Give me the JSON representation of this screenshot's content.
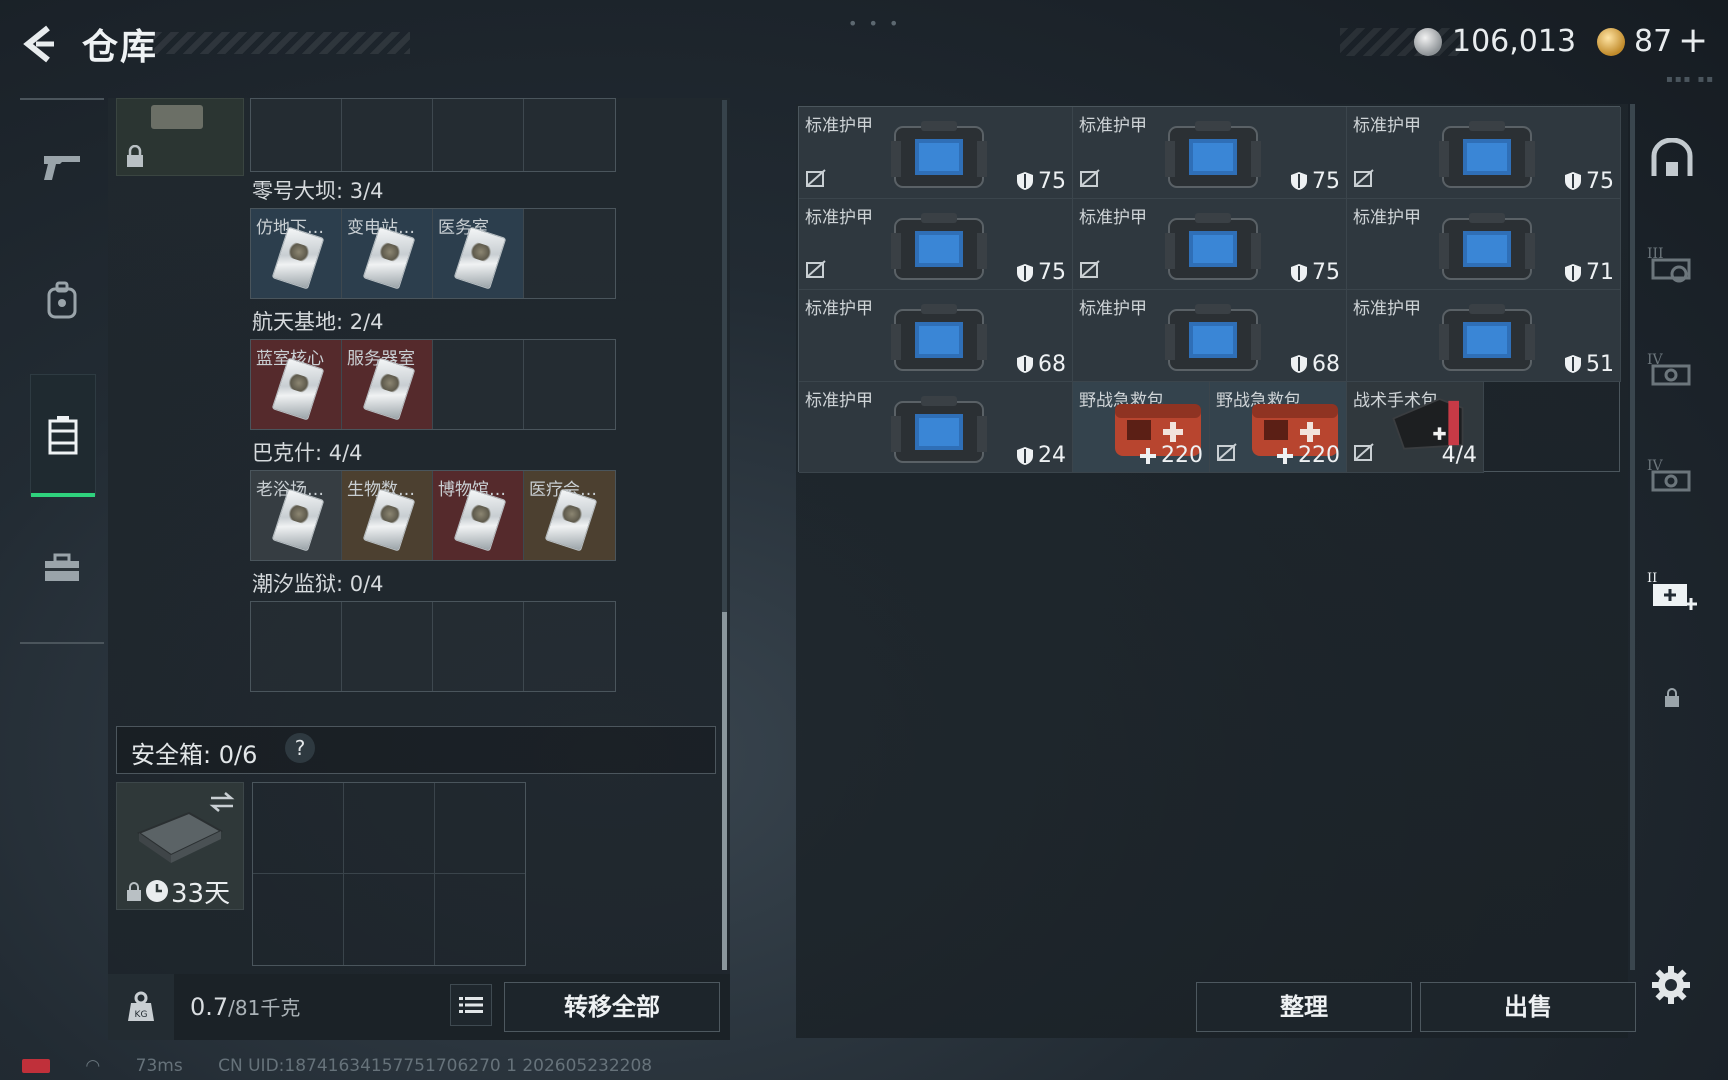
{
  "header": {
    "title": "仓库",
    "silver_amount": "106,013",
    "gold_amount": "87",
    "plus": "+"
  },
  "left_nav": [
    "weapon-icon",
    "backpack-icon",
    "case-icon",
    "toolbox-icon"
  ],
  "keycard_sections": [
    {
      "label": "零号大坝: 3/4",
      "slots": [
        {
          "name": "仿地下…",
          "color": "blue"
        },
        {
          "name": "变电站…",
          "color": "blue"
        },
        {
          "name": "医务室",
          "color": "blue"
        },
        {
          "name": "",
          "color": "empty"
        }
      ]
    },
    {
      "label": "航天基地: 2/4",
      "slots": [
        {
          "name": "蓝室核心",
          "color": "red"
        },
        {
          "name": "服务器室",
          "color": "red"
        },
        {
          "name": "",
          "color": "empty"
        },
        {
          "name": "",
          "color": "empty"
        }
      ]
    },
    {
      "label": "巴克什: 4/4",
      "slots": [
        {
          "name": "老浴场…",
          "color": "gray"
        },
        {
          "name": "生物数…",
          "color": "gold"
        },
        {
          "name": "博物馆…",
          "color": "red"
        },
        {
          "name": "医疗会…",
          "color": "gold"
        }
      ]
    },
    {
      "label": "潮汐监狱: 0/4",
      "slots": [
        {
          "name": "",
          "color": "empty"
        },
        {
          "name": "",
          "color": "empty"
        },
        {
          "name": "",
          "color": "empty"
        },
        {
          "name": "",
          "color": "empty"
        }
      ]
    }
  ],
  "safebox": {
    "label": "安全箱: 0/6",
    "help": "?",
    "timer": "33天"
  },
  "weight": {
    "current": "0.7",
    "max_unit": "/81千克"
  },
  "buttons": {
    "transfer_all": "转移全部",
    "arrange": "整理",
    "sell": "出售"
  },
  "inventory": [
    {
      "name": "标准护甲",
      "type": "armor",
      "value": "75",
      "nosell": true
    },
    {
      "name": "标准护甲",
      "type": "armor",
      "value": "75",
      "nosell": true
    },
    {
      "name": "标准护甲",
      "type": "armor",
      "value": "75",
      "nosell": true
    },
    {
      "name": "标准护甲",
      "type": "armor",
      "value": "75",
      "nosell": true
    },
    {
      "name": "标准护甲",
      "type": "armor",
      "value": "75",
      "nosell": true
    },
    {
      "name": "标准护甲",
      "type": "armor",
      "value": "71",
      "nosell": false
    },
    {
      "name": "标准护甲",
      "type": "armor",
      "value": "68",
      "nosell": false
    },
    {
      "name": "标准护甲",
      "type": "armor",
      "value": "68",
      "nosell": false
    },
    {
      "name": "标准护甲",
      "type": "armor",
      "value": "51",
      "nosell": false
    },
    {
      "name": "标准护甲",
      "type": "armor",
      "value": "24",
      "nosell": false
    },
    {
      "name": "野战急救包",
      "type": "medkit",
      "value": "220",
      "nosell": false
    },
    {
      "name": "野战急救包",
      "type": "medkit",
      "value": "220",
      "nosell": true
    },
    {
      "name": "战术手术包",
      "type": "surgkit",
      "value": "4/4",
      "nosell": true
    }
  ],
  "side_tabs": [
    "helmet-tab-icon",
    "armor-III-tab-icon",
    "armor-IV-tab-icon",
    "armor-IV-b-tab-icon",
    "medical-tab-icon",
    "lock-icon"
  ],
  "status": {
    "ping": "73ms",
    "uid": "CN UID:18741634157751706270 1  202605232208"
  },
  "colors": {
    "active_accent": "#2fd27d",
    "keycard_blue": "#2c3e4d",
    "keycard_red": "#552a2c",
    "keycard_gold": "#4c4030"
  }
}
